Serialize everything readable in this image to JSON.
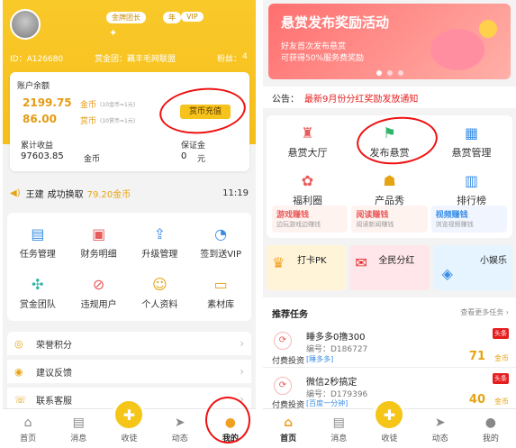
{
  "left": {
    "header": {
      "rank": "金牌团长",
      "year_badge": "年",
      "vip_badge": "VIP",
      "id_label": "ID：A126680",
      "team_label": "赏金团：藕丰毛网联盟",
      "fans_label": "粉丝：",
      "fans_count": "4"
    },
    "balance": {
      "title": "账户余额",
      "gold_value": "2199.75",
      "gold_label": "金币",
      "gold_note": "(10金币=1元)",
      "coin_value": "86.00",
      "coin_label": "赏币",
      "coin_note": "(10赏币=1元)",
      "recharge_btn": "赏币充值",
      "earn_title": "累计收益",
      "earn_value": "97603.85",
      "earn_unit": "金币",
      "deposit_title": "保证金",
      "deposit_value": "0",
      "deposit_unit": "元"
    },
    "ticker": {
      "user": "王建",
      "action": "成功换取",
      "amount": "79.20金币",
      "time": "11:19"
    },
    "menu": [
      {
        "label": "任务管理",
        "icon": "clipboard-icon"
      },
      {
        "label": "财务明细",
        "icon": "wallet-icon"
      },
      {
        "label": "升级管理",
        "icon": "upgrade-icon"
      },
      {
        "label": "签到送VIP",
        "icon": "checkin-icon"
      },
      {
        "label": "赏金团队",
        "icon": "network-icon"
      },
      {
        "label": "违规用户",
        "icon": "user-ban-icon"
      },
      {
        "label": "个人资料",
        "icon": "profile-icon"
      },
      {
        "label": "素材库",
        "icon": "folder-icon"
      }
    ],
    "list": [
      {
        "label": "荣誉积分",
        "icon": "medal-icon"
      },
      {
        "label": "建议反馈",
        "icon": "feedback-icon"
      },
      {
        "label": "联系客服",
        "icon": "service-icon"
      }
    ],
    "tabs": [
      "首页",
      "消息",
      "收徒",
      "动态",
      "我的"
    ]
  },
  "right": {
    "banner": {
      "title": "悬赏发布奖励活动",
      "line1": "好友首次发布悬赏",
      "line2": "可获得50%服务费奖励"
    },
    "notice": {
      "label": "公告：",
      "text": "最新9月份分红奖励发放通知"
    },
    "menu": [
      {
        "label": "悬赏大厅",
        "icon": "hall-icon"
      },
      {
        "label": "发布悬赏",
        "icon": "flag-icon"
      },
      {
        "label": "悬赏管理",
        "icon": "manage-icon"
      },
      {
        "label": "福利圈",
        "icon": "gift-icon"
      },
      {
        "label": "产品秀",
        "icon": "show-icon"
      },
      {
        "label": "排行榜",
        "icon": "rank-icon"
      }
    ],
    "earn_cards": [
      {
        "title": "游戏赚钱",
        "sub": "边玩游戏边赚钱"
      },
      {
        "title": "阅读赚钱",
        "sub": "阅读新闻赚钱"
      },
      {
        "title": "视频赚钱",
        "sub": "浏览视频赚钱"
      }
    ],
    "promos": [
      "打卡PK",
      "全民分红",
      "小娱乐"
    ],
    "tasks_title": "推荐任务",
    "tasks_more": "查看更多任务 ›",
    "tasks": [
      {
        "title": "睡多多0撸300",
        "id": "编号：D186727",
        "tag": "[睡多多]",
        "type": "付费投资",
        "reward": "71",
        "unit": "金币",
        "badge": "头条"
      },
      {
        "title": "微信2秒搞定",
        "id": "编号：D179396",
        "tag": "[百度一分钟]",
        "type": "付费投资",
        "reward": "40",
        "unit": "金币",
        "badge": "头条"
      }
    ],
    "tabs": [
      "首页",
      "消息",
      "收徒",
      "动态",
      "我的"
    ]
  },
  "colors": {
    "brand_yellow": "#f6c21c",
    "accent_orange": "#f0a020",
    "alert_red": "#e41e1e"
  }
}
